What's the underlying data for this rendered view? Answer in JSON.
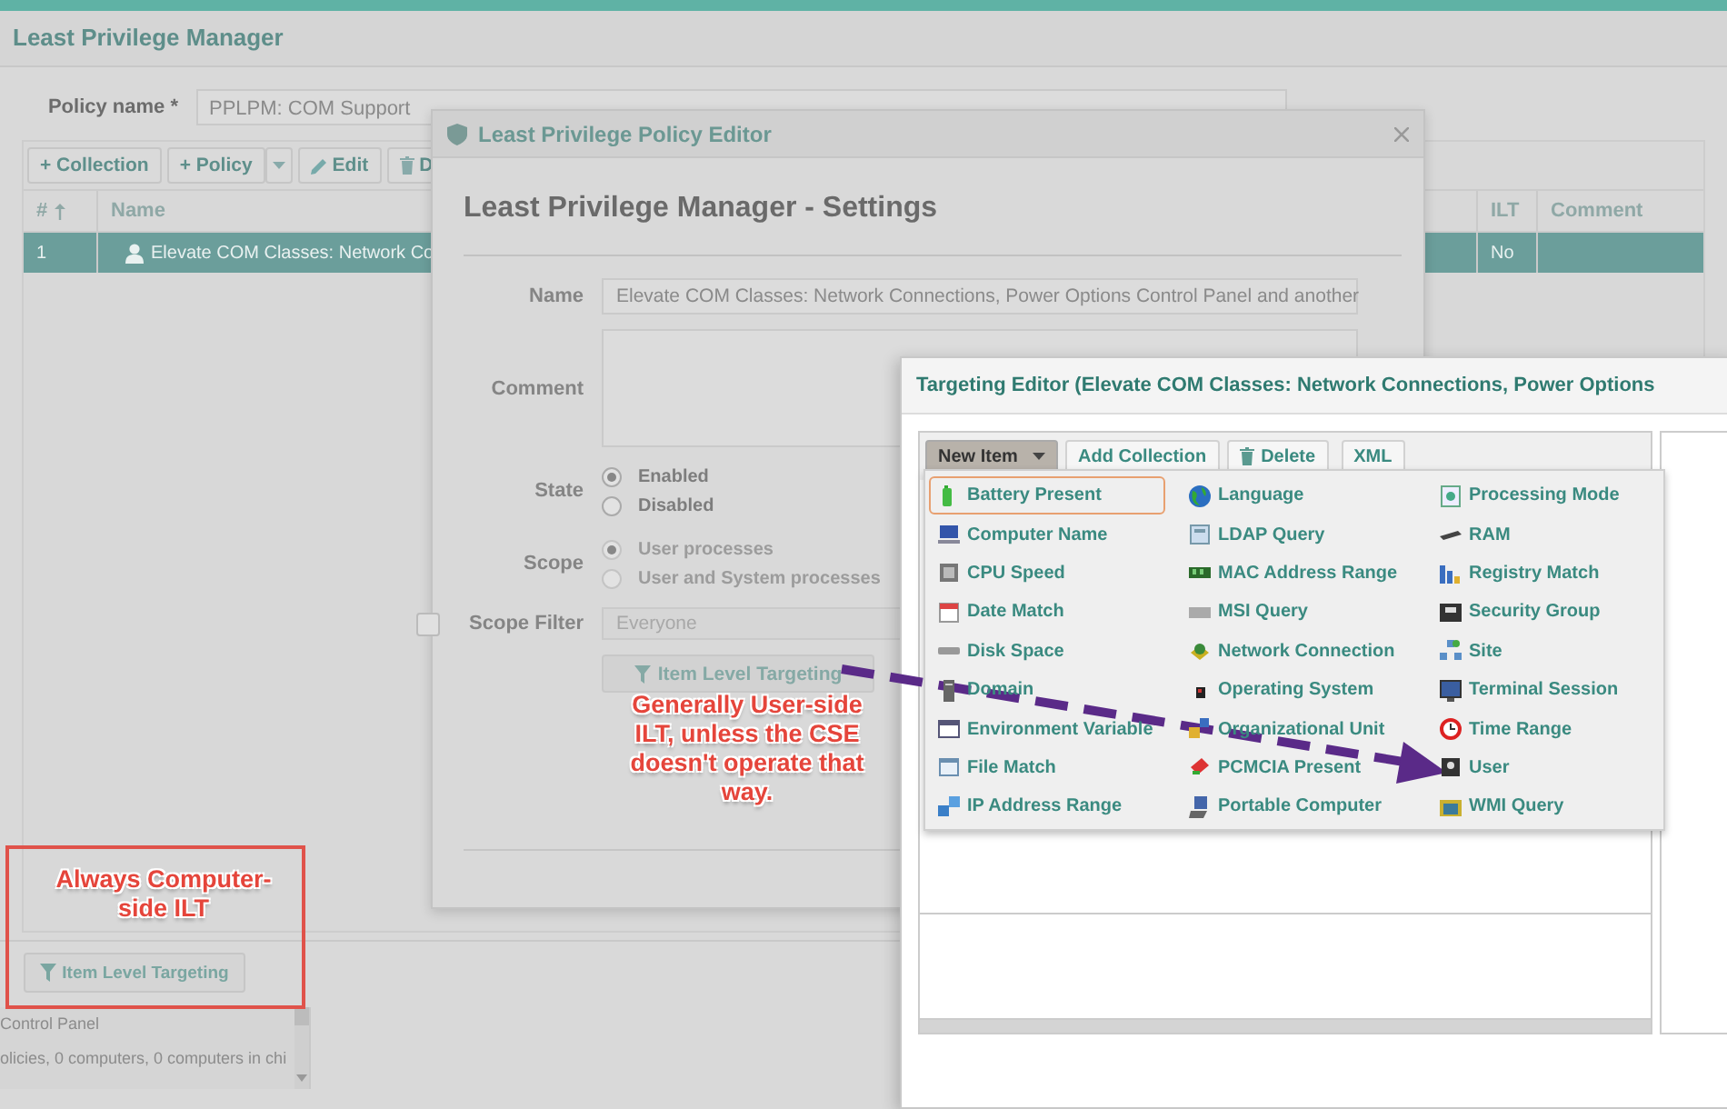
{
  "app": {
    "title": "Least Privilege Manager",
    "policy_name": {
      "label": "Policy name *",
      "value": "PPLPM: COM Support"
    },
    "toolbar": [
      {
        "label": "+ Collection",
        "kind": "plain"
      },
      {
        "label": "+ Policy",
        "kind": "split"
      },
      {
        "label": "Edit",
        "kind": "edit"
      },
      {
        "label": "D",
        "kind": "delete"
      }
    ],
    "table": {
      "columns": [
        "#",
        "Name",
        "ILT",
        "Comment"
      ],
      "rows": [
        {
          "number": "1",
          "name": "Elevate COM Classes: Network Co",
          "ilt": "No",
          "selected": true
        }
      ]
    },
    "targeting_button": "Item Level Targeting",
    "list_lines": [
      "Control Panel",
      "olicies, 0 computers, 0 computers in chi"
    ]
  },
  "policy_editor": {
    "title": "Least Privilege Policy Editor",
    "heading": "Least Privilege Manager - Settings",
    "name": {
      "label": "Name",
      "value": "Elevate COM Classes: Network Connections, Power Options Control Panel and another"
    },
    "comment": {
      "label": "Comment"
    },
    "state": {
      "label": "State",
      "disabled": false,
      "options": [
        {
          "label": "Enabled",
          "selected": true
        },
        {
          "label": "Disabled",
          "selected": false
        }
      ]
    },
    "scope": {
      "label": "Scope",
      "disabled": true,
      "options": [
        {
          "label": "User processes",
          "selected": true
        },
        {
          "label": "User and System processes",
          "selected": false
        }
      ]
    },
    "scope_filter": {
      "label": "Scope Filter",
      "checked": false,
      "placeholder": "Everyone"
    },
    "targeting_button": "Item Level Targeting"
  },
  "targeting_editor": {
    "title": "Targeting Editor (Elevate COM Classes: Network Connections, Power Options",
    "toolbar": [
      {
        "label": "New Item",
        "kind": "dropdown"
      },
      {
        "label": "Add Collection",
        "kind": "plain"
      },
      {
        "label": "Delete",
        "kind": "delete"
      },
      {
        "label": "XML",
        "kind": "plain"
      }
    ],
    "menu_items": [
      {
        "label": "Battery Present",
        "selected": true
      },
      {
        "label": "Computer Name",
        "selected": false
      },
      {
        "label": "CPU Speed",
        "selected": false
      },
      {
        "label": "Date Match",
        "selected": false
      },
      {
        "label": "Disk Space",
        "selected": false
      },
      {
        "label": "Domain",
        "selected": false
      },
      {
        "label": "Environment Variable",
        "selected": false
      },
      {
        "label": "File Match",
        "selected": false
      },
      {
        "label": "IP Address Range",
        "selected": false
      },
      {
        "label": "Language",
        "selected": false
      },
      {
        "label": "LDAP Query",
        "selected": false
      },
      {
        "label": "MAC Address Range",
        "selected": false
      },
      {
        "label": "MSI Query",
        "selected": false
      },
      {
        "label": "Network Connection",
        "selected": false
      },
      {
        "label": "Operating System",
        "selected": false
      },
      {
        "label": "Organizational Unit",
        "selected": false
      },
      {
        "label": "PCMCIA Present",
        "selected": false
      },
      {
        "label": "Portable Computer",
        "selected": false
      },
      {
        "label": "Processing Mode",
        "selected": false
      },
      {
        "label": "RAM",
        "selected": false
      },
      {
        "label": "Registry Match",
        "selected": false
      },
      {
        "label": "Security Group",
        "selected": false
      },
      {
        "label": "Site",
        "selected": false
      },
      {
        "label": "Terminal Session",
        "selected": false
      },
      {
        "label": "Time Range",
        "selected": false
      },
      {
        "label": "User",
        "selected": false
      },
      {
        "label": "WMI Query",
        "selected": false
      }
    ]
  },
  "annotations": [
    {
      "kind": "note",
      "text": "Generally User-side ILT, unless the CSE doesn't operate that way."
    },
    {
      "kind": "boxed",
      "text": "Always Computer-side ILT"
    },
    {
      "kind": "arrow"
    }
  ]
}
